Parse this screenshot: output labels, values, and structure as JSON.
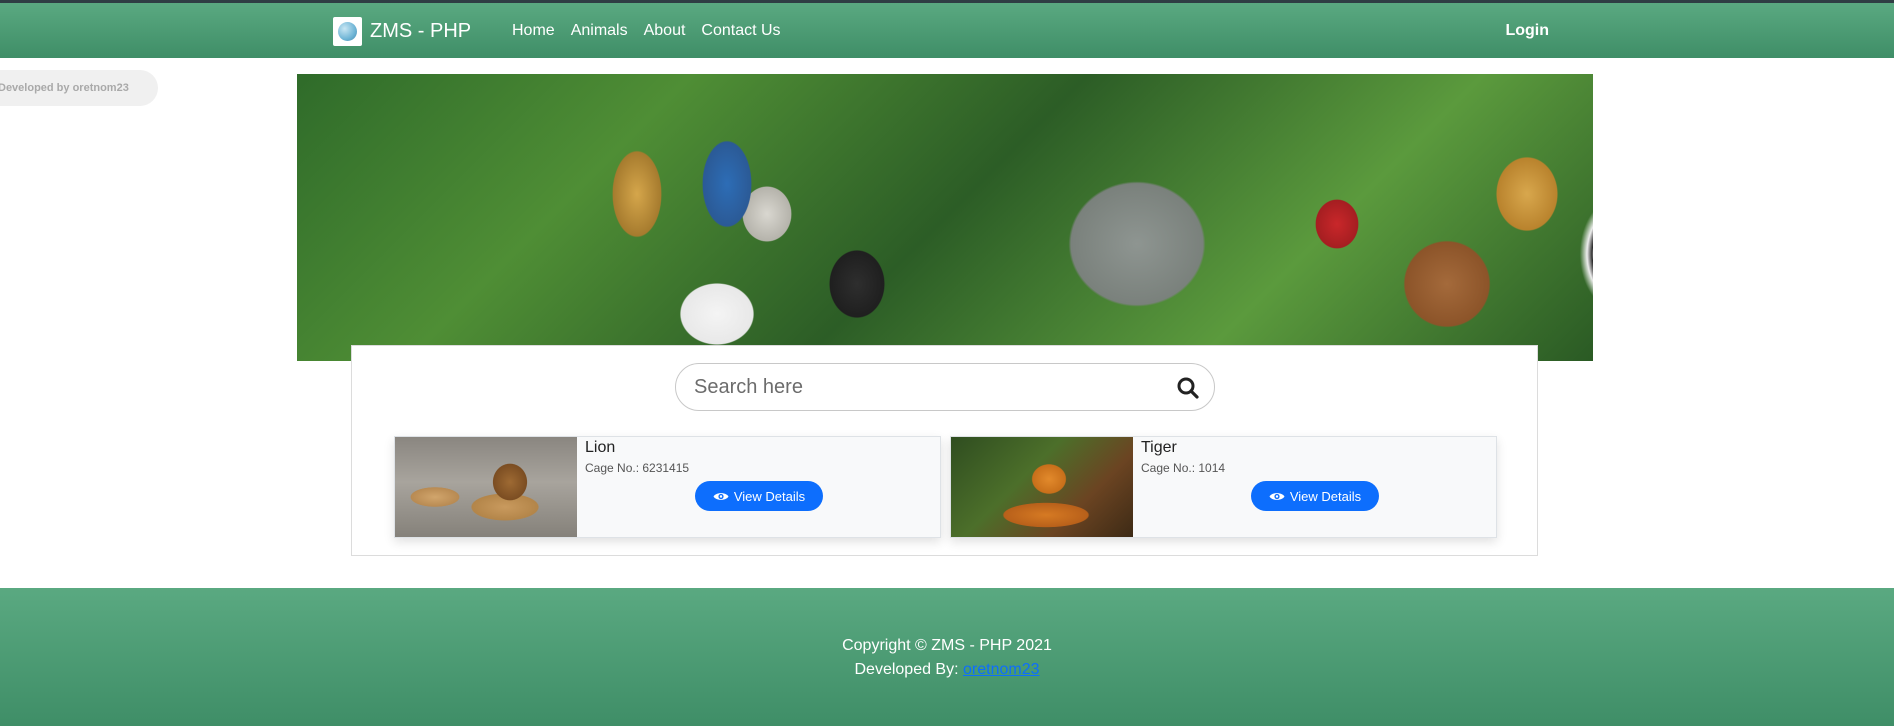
{
  "navbar": {
    "brand": "ZMS - PHP",
    "links": [
      "Home",
      "Animals",
      "About",
      "Contact Us"
    ],
    "login": "Login"
  },
  "dev_badge": "Developed by oretnom23",
  "search": {
    "placeholder": "Search here"
  },
  "animals": [
    {
      "name": "Lion",
      "cage": "Cage No.: 6231415",
      "button": "View Details"
    },
    {
      "name": "Tiger",
      "cage": "Cage No.: 1014",
      "button": "View Details"
    }
  ],
  "footer": {
    "copyright": "Copyright © ZMS - PHP 2021",
    "developed_by_label": "Developed By: ",
    "developer": "oretnom23"
  },
  "colors": {
    "nav_green": "#4f9f77",
    "button_blue": "#0d6efd"
  }
}
